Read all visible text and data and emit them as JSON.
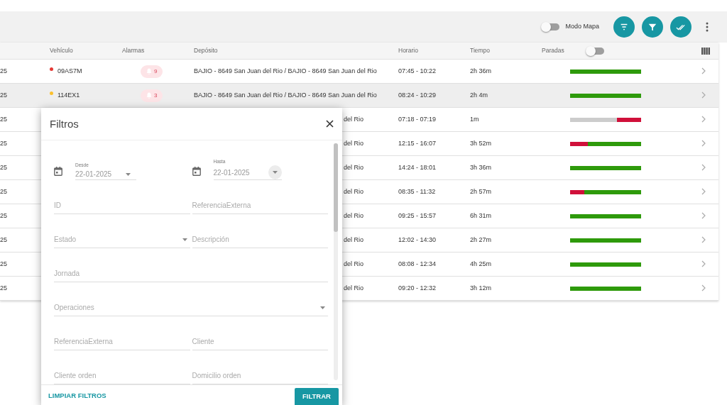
{
  "toolbar": {
    "map_mode": {
      "label": "Modo Mapa",
      "on": false
    }
  },
  "table": {
    "columns": [
      "",
      "Vehículo",
      "Alarmas",
      "Depósito",
      "Horario",
      "Tiempo",
      "Paradas"
    ],
    "paradas_switch": {
      "on": false
    },
    "rows": [
      {
        "date": "25",
        "vehicle": "09AS7M",
        "color": "#e53935",
        "alarms": "9",
        "deposito": "BAJIO - 8649 San Juan del Rio / BAJIO - 8649 San Juan del Rio",
        "covered": false,
        "selected": false,
        "horario": "07:45 - 10:22",
        "tiempo": "2h 36m",
        "segments": [
          {
            "color": "#2e9a0b",
            "level": 1
          }
        ]
      },
      {
        "date": "25",
        "vehicle": "114EX1",
        "color": "#fbc02d",
        "alarms": "3",
        "deposito": "BAJIO - 8649 San Juan del Rio / BAJIO - 8649 San Juan del Rio",
        "covered": false,
        "selected": true,
        "horario": "08:24 - 10:29",
        "tiempo": "2h 4m",
        "segments": [
          {
            "color": "#2e9a0b",
            "level": 1
          }
        ]
      },
      {
        "date": "25",
        "deposito": "del Rio",
        "covered": true,
        "selected": false,
        "horario": "07:18 - 07:19",
        "tiempo": "1m",
        "segments": [
          {
            "color": "#cccccc",
            "level": 0.66
          },
          {
            "color": "#d0103a",
            "level": 0.34
          }
        ]
      },
      {
        "date": "25",
        "deposito": "del Rio",
        "covered": true,
        "selected": false,
        "horario": "12:15 - 16:07",
        "tiempo": "3h 52m",
        "segments": [
          {
            "color": "#d0103a",
            "level": 0.25
          },
          {
            "color": "#2e9a0b",
            "level": 0.75
          }
        ]
      },
      {
        "date": "25",
        "deposito": "del Rio",
        "covered": true,
        "selected": false,
        "horario": "14:24 - 18:01",
        "tiempo": "3h 36m",
        "segments": [
          {
            "color": "#2e9a0b",
            "level": 1
          }
        ]
      },
      {
        "date": "25",
        "deposito": "del Rio",
        "covered": true,
        "selected": false,
        "horario": "08:35 - 11:32",
        "tiempo": "2h 57m",
        "segments": [
          {
            "color": "#d0103a",
            "level": 0.2
          },
          {
            "color": "#2e9a0b",
            "level": 0.8
          }
        ]
      },
      {
        "date": "25",
        "deposito": "del Rio",
        "covered": true,
        "selected": false,
        "horario": "09:25 - 15:57",
        "tiempo": "6h 31m",
        "segments": [
          {
            "color": "#2e9a0b",
            "level": 1
          }
        ]
      },
      {
        "date": "25",
        "deposito": "del Rio",
        "covered": true,
        "selected": false,
        "horario": "12:02 - 14:30",
        "tiempo": "2h 27m",
        "segments": [
          {
            "color": "#2e9a0b",
            "level": 1
          }
        ]
      },
      {
        "date": "25",
        "deposito": "del Rio",
        "covered": true,
        "selected": false,
        "horario": "08:08 - 12:34",
        "tiempo": "4h 25m",
        "segments": [
          {
            "color": "#2e9a0b",
            "level": 1
          }
        ]
      },
      {
        "date": "25",
        "deposito": "del Rio",
        "covered": true,
        "selected": false,
        "horario": "09:20 - 12:32",
        "tiempo": "3h 12m",
        "segments": [
          {
            "color": "#2e9a0b",
            "level": 1
          }
        ]
      }
    ]
  },
  "dialog": {
    "title": "Filtros",
    "rows": [
      [
        {
          "kind": "date",
          "label": "Desde",
          "value": "22-01-2025"
        },
        {
          "kind": "date",
          "label": "Hasta",
          "value": "22-01-2025"
        }
      ],
      [
        {
          "kind": "text",
          "placeholder": "ID"
        },
        {
          "kind": "text",
          "placeholder": "ReferenciaExterna"
        }
      ],
      [
        {
          "kind": "select",
          "placeholder": "Estado"
        },
        {
          "kind": "text",
          "placeholder": "Descripción"
        }
      ],
      [
        {
          "kind": "text",
          "placeholder": "Jornada"
        }
      ],
      [
        {
          "kind": "select",
          "placeholder": "Operaciones"
        }
      ],
      [
        {
          "kind": "text",
          "placeholder": "ReferenciaExterna"
        },
        {
          "kind": "text",
          "placeholder": "Cliente"
        }
      ],
      [
        {
          "kind": "text",
          "placeholder": "Cliente orden"
        },
        {
          "kind": "text",
          "placeholder": "Domicilio orden"
        }
      ]
    ],
    "clear_button": "LIMPIAR FILTROS",
    "apply_button": "FILTRAR"
  }
}
